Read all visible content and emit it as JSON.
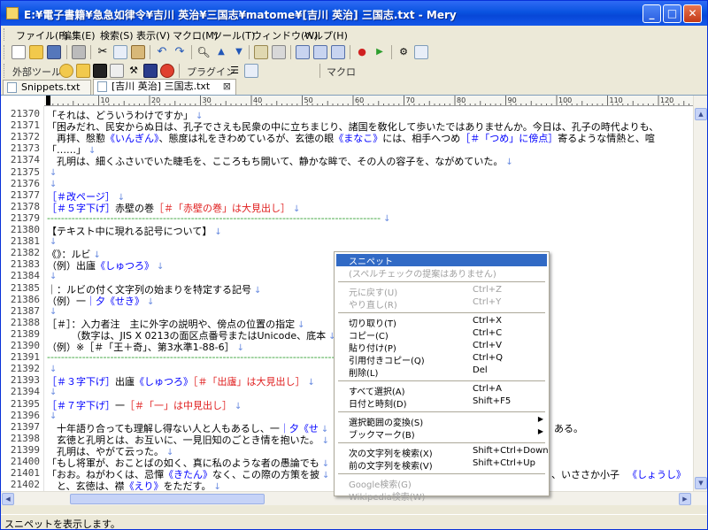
{
  "window": {
    "title": "E:¥電子書籍¥急急如律令¥吉川 英治¥三国志¥matome¥[吉川 英治] 三国志.txt - Mery",
    "buttons": {
      "minimize": "_",
      "maximize": "□",
      "close": "✕"
    }
  },
  "menu": [
    "ファイル(F)",
    "編集(E)",
    "検索(S)",
    "表示(V)",
    "マクロ(M)",
    "ツール(T)",
    "ウィンドウ(W)",
    "ヘルプ(H)"
  ],
  "toolbar2": {
    "tools_label": "外部ツール",
    "plugins_label": "プラグイン",
    "macro_label": "マクロ"
  },
  "tabs": [
    {
      "label": "Snippets.txt",
      "active": false
    },
    {
      "label": "[吉川 英治] 三国志.txt",
      "active": true,
      "close": "⊠"
    }
  ],
  "ruler": {
    "marks": [
      "10",
      "20",
      "30",
      "40",
      "50",
      "60",
      "70",
      "80",
      "90",
      "100",
      "110",
      "120"
    ]
  },
  "lines": [
    {
      "num": "21370",
      "segs": [
        {
          "t": "「それは、どういうわけですか」",
          "c": ""
        }
      ]
    },
    {
      "num": "21371",
      "segs": [
        {
          "t": "「困みだれ、民安からぬ日は、孔子でさえも民衆の中に立ちまじり、諸国を敎化して歩いたではありませんか。今日は、孔子の時代よりも、",
          "c": ""
        }
      ]
    },
    {
      "num": "21372",
      "segs": [
        {
          "t": "　再拝、慇懃",
          "c": ""
        },
        {
          "t": "《いんぎん》",
          "c": "ruby"
        },
        {
          "t": "、態度は礼をきわめているが、玄徳の眼",
          "c": ""
        },
        {
          "t": "《まなこ》",
          "c": "ruby"
        },
        {
          "t": "には、相手へつめ",
          "c": ""
        },
        {
          "t": "［＃「つめ」に傍点］",
          "c": "lbl"
        },
        {
          "t": "寄るような情熱と、喧",
          "c": ""
        }
      ]
    },
    {
      "num": "21373",
      "segs": [
        {
          "t": "「……」",
          "c": ""
        }
      ]
    },
    {
      "num": "21374",
      "segs": [
        {
          "t": "　孔明は、細くふさいでいた睫毛を、こころもち開いて、静かな眸で、その人の容子を、ながめていた。",
          "c": ""
        }
      ]
    },
    {
      "num": "21375",
      "segs": []
    },
    {
      "num": "21376",
      "segs": []
    },
    {
      "num": "21377",
      "segs": [
        {
          "t": "［＃改ページ］",
          "c": "lbl"
        }
      ]
    },
    {
      "num": "21378",
      "segs": [
        {
          "t": "［＃５字下げ］",
          "c": "lbl"
        },
        {
          "t": "赤壁の巻",
          "c": ""
        },
        {
          "t": "［＃「赤壁の巻」は大見出し］",
          "c": "note"
        }
      ]
    },
    {
      "num": "21379",
      "segs": [
        {
          "t": "-----------------------------------------------------------------------------------------------",
          "c": "sep"
        }
      ]
    },
    {
      "num": "21380",
      "segs": [
        {
          "t": "【テキスト中に現れる記号について】",
          "c": ""
        }
      ]
    },
    {
      "num": "21381",
      "segs": []
    },
    {
      "num": "21382",
      "segs": [
        {
          "t": "《》：ルビ",
          "c": ""
        }
      ]
    },
    {
      "num": "21383",
      "segs": [
        {
          "t": "（例）出廬",
          "c": ""
        },
        {
          "t": "《しゅつろ》",
          "c": "ruby"
        }
      ]
    },
    {
      "num": "21384",
      "segs": []
    },
    {
      "num": "21385",
      "segs": [
        {
          "t": "｜：ルビの付く文字列の始まりを特定する記号",
          "c": ""
        }
      ]
    },
    {
      "num": "21386",
      "segs": [
        {
          "t": "（例）一",
          "c": ""
        },
        {
          "t": "｜夕",
          "c": "ruby"
        },
        {
          "t": "《せき》",
          "c": "ruby"
        }
      ]
    },
    {
      "num": "21387",
      "segs": []
    },
    {
      "num": "21388",
      "segs": [
        {
          "t": "［＃］：入力者注　主に外字の説明や、傍点の位置の指定",
          "c": ""
        }
      ]
    },
    {
      "num": "21389",
      "segs": [
        {
          "t": "　　　（数字は、JIS X 0213の面区点番号またはUnicode、底本",
          "c": ""
        }
      ]
    },
    {
      "num": "21390",
      "segs": [
        {
          "t": "（例）※［＃「王＋奇」、第3水準1-88-6］",
          "c": ""
        }
      ]
    },
    {
      "num": "21391",
      "segs": [
        {
          "t": "-----------------------------------------------------------------------------------------------",
          "c": "sep"
        }
      ]
    },
    {
      "num": "21392",
      "segs": []
    },
    {
      "num": "21393",
      "segs": [
        {
          "t": "［＃３字下げ］",
          "c": "lbl"
        },
        {
          "t": "出廬",
          "c": ""
        },
        {
          "t": "《しゅつろ》",
          "c": "ruby"
        },
        {
          "t": "［＃「出廬」は大見出し］",
          "c": "note"
        }
      ]
    },
    {
      "num": "21394",
      "segs": []
    },
    {
      "num": "21395",
      "segs": [
        {
          "t": "［＃７字下げ］",
          "c": "lbl"
        },
        {
          "t": "一",
          "c": ""
        },
        {
          "t": "［＃「一」は中見出し］",
          "c": "note"
        }
      ]
    },
    {
      "num": "21396",
      "segs": []
    },
    {
      "num": "21397",
      "segs": [
        {
          "t": "　十年語り合っても理解し得ない人と人もあるし、一",
          "c": ""
        },
        {
          "t": "｜夕《せ",
          "c": "ruby"
        }
      ]
    },
    {
      "num": "21398",
      "segs": [
        {
          "t": "　玄徳と孔明とは、お互いに、一見旧知のごとき情を抱いた。",
          "c": ""
        }
      ]
    },
    {
      "num": "21399",
      "segs": [
        {
          "t": "　孔明は、やがて云った。",
          "c": ""
        }
      ]
    },
    {
      "num": "21400",
      "segs": [
        {
          "t": "「もし将軍が、おことばの如く、真に私のような者の愚論でも",
          "c": ""
        }
      ]
    },
    {
      "num": "21401",
      "segs": [
        {
          "t": "「おお。ねがわくは、忌憚",
          "c": ""
        },
        {
          "t": "《きたん》",
          "c": "ruby"
        },
        {
          "t": "なく、この際の方策を披",
          "c": ""
        }
      ]
    },
    {
      "num": "21402",
      "segs": [
        {
          "t": "　と、玄徳は、襟",
          "c": ""
        },
        {
          "t": "《えり》",
          "c": "ruby"
        },
        {
          "t": "をただす。",
          "c": ""
        }
      ]
    }
  ],
  "tail_text": {
    "l21397": "ある。",
    "l21401": "、いささか小子",
    "l21401_ruby": "《しょうし》"
  },
  "context_menu": [
    {
      "label": "スニペット",
      "key": "",
      "state": "selected"
    },
    {
      "label": "(スペルチェックの提案はありません)",
      "key": "",
      "state": "disabled"
    },
    {
      "sep": true
    },
    {
      "label": "元に戻す(U)",
      "key": "Ctrl+Z",
      "state": "disabled"
    },
    {
      "label": "やり直し(R)",
      "key": "Ctrl+Y",
      "state": "disabled"
    },
    {
      "sep": true
    },
    {
      "label": "切り取り(T)",
      "key": "Ctrl+X",
      "state": ""
    },
    {
      "label": "コピー(C)",
      "key": "Ctrl+C",
      "state": ""
    },
    {
      "label": "貼り付け(P)",
      "key": "Ctrl+V",
      "state": ""
    },
    {
      "label": "引用付きコピー(Q)",
      "key": "Ctrl+Q",
      "state": ""
    },
    {
      "label": "削除(L)",
      "key": "Del",
      "state": ""
    },
    {
      "sep": true
    },
    {
      "label": "すべて選択(A)",
      "key": "Ctrl+A",
      "state": ""
    },
    {
      "label": "日付と時刻(D)",
      "key": "Shift+F5",
      "state": ""
    },
    {
      "sep": true
    },
    {
      "label": "選択範囲の変換(S)",
      "key": "",
      "state": "",
      "submenu": "▶"
    },
    {
      "label": "ブックマーク(B)",
      "key": "",
      "state": "",
      "submenu": "▶"
    },
    {
      "sep": true
    },
    {
      "label": "次の文字列を検索(X)",
      "key": "Shift+Ctrl+Down",
      "state": ""
    },
    {
      "label": "前の文字列を検索(V)",
      "key": "Shift+Ctrl+Up",
      "state": ""
    },
    {
      "sep": true
    },
    {
      "label": "Google検索(G)",
      "key": "",
      "state": "disabled"
    },
    {
      "label": "Wikipedia検索(W)",
      "key": "",
      "state": "disabled"
    }
  ],
  "status": {
    "text": "スニペットを表示します。"
  },
  "colors": {
    "titlebar": "#0A53E0",
    "selection": "#316AC5",
    "ruby": "#0000FF",
    "note": "#E02020",
    "separator": "#2E9E2E"
  }
}
